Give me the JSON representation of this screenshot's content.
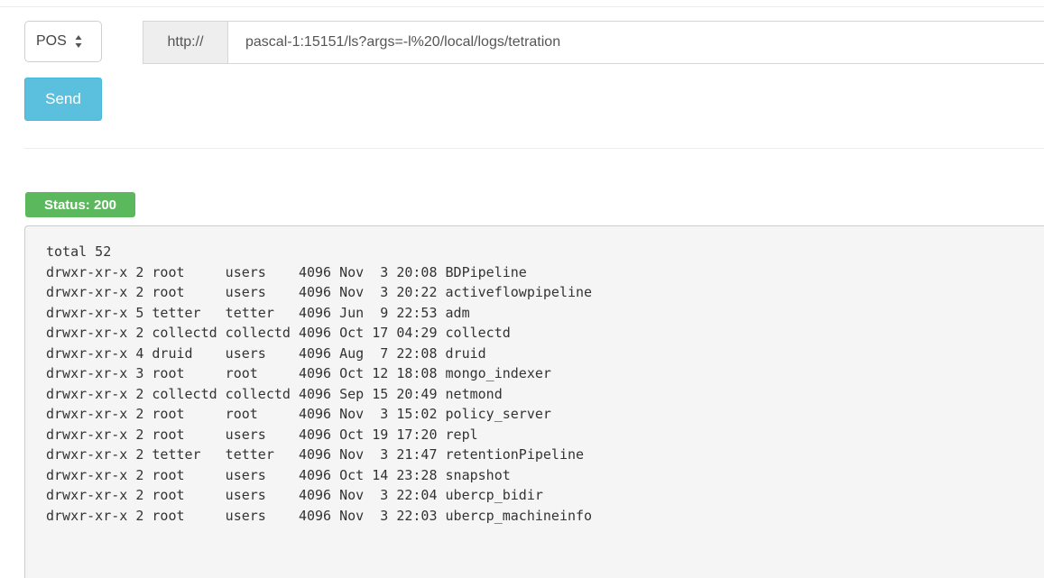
{
  "request": {
    "method": "POS",
    "url_prefix": "http://",
    "url": "pascal-1:15151/ls?args=-l%20/local/logs/tetration",
    "send_label": "Send"
  },
  "response": {
    "status": "Status: 200",
    "lines": [
      "total 52",
      "drwxr-xr-x 2 root     users    4096 Nov  3 20:08 BDPipeline",
      "drwxr-xr-x 2 root     users    4096 Nov  3 20:22 activeflowpipeline",
      "drwxr-xr-x 5 tetter   tetter   4096 Jun  9 22:53 adm",
      "drwxr-xr-x 2 collectd collectd 4096 Oct 17 04:29 collectd",
      "drwxr-xr-x 4 druid    users    4096 Aug  7 22:08 druid",
      "drwxr-xr-x 3 root     root     4096 Oct 12 18:08 mongo_indexer",
      "drwxr-xr-x 2 collectd collectd 4096 Sep 15 20:49 netmond",
      "drwxr-xr-x 2 root     root     4096 Nov  3 15:02 policy_server",
      "drwxr-xr-x 2 root     users    4096 Oct 19 17:20 repl",
      "drwxr-xr-x 2 tetter   tetter   4096 Nov  3 21:47 retentionPipeline",
      "drwxr-xr-x 2 root     users    4096 Oct 14 23:28 snapshot",
      "drwxr-xr-x 2 root     users    4096 Nov  3 22:04 ubercp_bidir",
      "drwxr-xr-x 2 root     users    4096 Nov  3 22:03 ubercp_machineinfo"
    ]
  },
  "colors": {
    "send_button": "#5bc0de",
    "status_badge": "#5cb85c",
    "response_bg": "#f5f5f5"
  },
  "icons": {
    "method_select": "select-arrows-icon"
  }
}
